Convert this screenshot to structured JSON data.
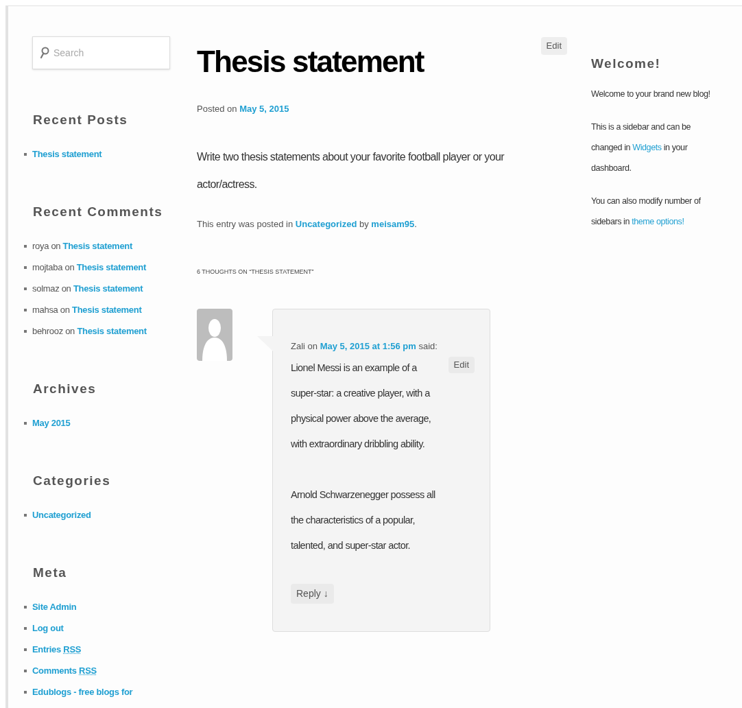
{
  "search": {
    "placeholder": "Search"
  },
  "left_sidebar": [
    {
      "title": "Recent Posts",
      "items": [
        {
          "parts": [
            {
              "kind": "link",
              "text": "Thesis statement"
            }
          ]
        }
      ]
    },
    {
      "title": "Recent Comments",
      "items": [
        {
          "parts": [
            {
              "kind": "text",
              "text": "roya on "
            },
            {
              "kind": "link",
              "text": "Thesis statement"
            }
          ]
        },
        {
          "parts": [
            {
              "kind": "text",
              "text": "mojtaba on "
            },
            {
              "kind": "link",
              "text": "Thesis statement"
            }
          ]
        },
        {
          "parts": [
            {
              "kind": "text",
              "text": "solmaz on "
            },
            {
              "kind": "link",
              "text": "Thesis statement"
            }
          ]
        },
        {
          "parts": [
            {
              "kind": "text",
              "text": "mahsa on "
            },
            {
              "kind": "link",
              "text": "Thesis statement"
            }
          ]
        },
        {
          "parts": [
            {
              "kind": "text",
              "text": "behrooz on "
            },
            {
              "kind": "link",
              "text": "Thesis statement"
            }
          ]
        }
      ]
    },
    {
      "title": "Archives",
      "items": [
        {
          "parts": [
            {
              "kind": "link",
              "text": "May 2015"
            }
          ]
        }
      ]
    },
    {
      "title": "Categories",
      "items": [
        {
          "parts": [
            {
              "kind": "link",
              "text": "Uncategorized"
            }
          ]
        }
      ]
    },
    {
      "title": "Meta",
      "items": [
        {
          "parts": [
            {
              "kind": "link",
              "text": "Site Admin"
            }
          ]
        },
        {
          "parts": [
            {
              "kind": "link",
              "text": "Log out"
            }
          ]
        },
        {
          "parts": [
            {
              "kind": "link",
              "text": "Entries",
              "abbr": "RSS"
            }
          ]
        },
        {
          "parts": [
            {
              "kind": "link",
              "text": "Comments",
              "abbr": "RSS"
            }
          ]
        },
        {
          "parts": [
            {
              "kind": "link",
              "text": "Edublogs - free blogs for"
            }
          ]
        }
      ]
    }
  ],
  "post": {
    "edit_label": "Edit",
    "title": "Thesis statement",
    "posted": [
      {
        "kind": "text",
        "text": "Posted on "
      },
      {
        "kind": "link",
        "text": "May 5, 2015"
      }
    ],
    "content": "Write two thesis statements about your favorite football player or your actor/actress.",
    "footer": [
      {
        "kind": "text",
        "text": "This entry was posted in "
      },
      {
        "kind": "link",
        "text": "Uncategorized"
      },
      {
        "kind": "text",
        "text": " by "
      },
      {
        "kind": "link",
        "text": "meisam95"
      },
      {
        "kind": "text",
        "text": "."
      }
    ],
    "comments_title": "6 THOUGHTS ON “THESIS STATEMENT”"
  },
  "comments": [
    {
      "meta": [
        {
          "kind": "text",
          "text": "Zali on "
        },
        {
          "kind": "link",
          "text": "May 5, 2015 at 1:56 pm"
        },
        {
          "kind": "text",
          "text": " said:"
        }
      ],
      "edit_label": "Edit",
      "paragraphs": [
        "Lionel Messi is an example of a super-star: a creative player, with a physical power above the average, with extraordinary dribbling ability.",
        "Arnold Schwarzenegger possess all the characteristics of a popular, talented, and super-star actor."
      ],
      "reply_label": "Reply ↓"
    }
  ],
  "right_sidebar": {
    "title": "Welcome!",
    "paragraphs": [
      [
        {
          "kind": "text",
          "text": "Welcome to your brand new blog!"
        }
      ],
      [
        {
          "kind": "text",
          "text": "This is a sidebar and can be changed in "
        },
        {
          "kind": "link",
          "text": "Widgets"
        },
        {
          "kind": "text",
          "text": " in your dashboard."
        }
      ],
      [
        {
          "kind": "text",
          "text": "You can also modify number of sidebars in "
        },
        {
          "kind": "link",
          "text": "theme options!"
        }
      ]
    ]
  }
}
